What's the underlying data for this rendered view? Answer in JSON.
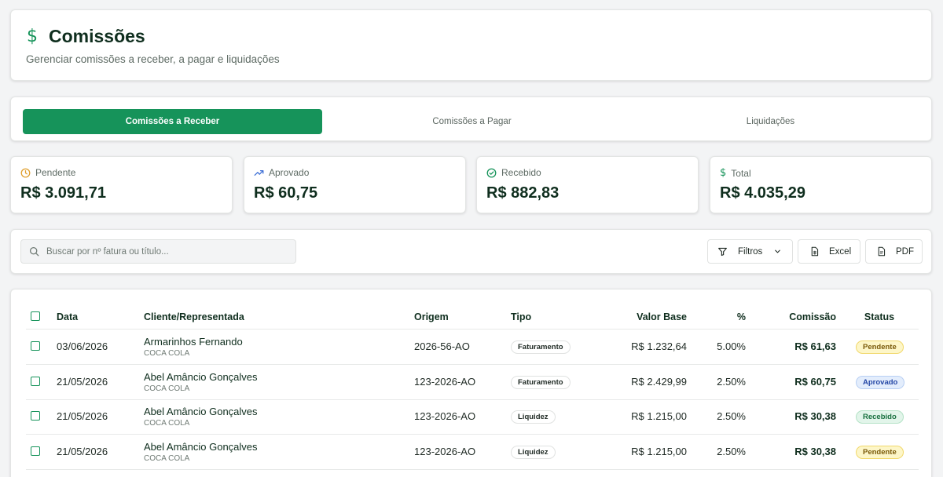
{
  "header": {
    "icon": "dollar-icon",
    "title": "Comissões",
    "subtitle": "Gerenciar comissões a receber, a pagar e liquidações"
  },
  "tabs": [
    {
      "label": "Comissões a Receber",
      "active": true
    },
    {
      "label": "Comissões a Pagar",
      "active": false
    },
    {
      "label": "Liquidações",
      "active": false
    }
  ],
  "stats": [
    {
      "label": "Pendente",
      "value": "R$ 3.091,71",
      "icon": "clock-icon",
      "color": "#e0a030"
    },
    {
      "label": "Aprovado",
      "value": "R$ 60,75",
      "icon": "trending-up-icon",
      "color": "#3d6fd6"
    },
    {
      "label": "Recebido",
      "value": "R$ 882,83",
      "icon": "check-circle-icon",
      "color": "#16935a"
    },
    {
      "label": "Total",
      "value": "R$ 4.035,29",
      "icon": "dollar-icon",
      "color": "#16935a"
    }
  ],
  "toolbar": {
    "search_placeholder": "Buscar por nº fatura ou título...",
    "filters_label": "Filtros",
    "excel_label": "Excel",
    "pdf_label": "PDF"
  },
  "table": {
    "columns": {
      "data": "Data",
      "cliente": "Cliente/Representada",
      "origem": "Origem",
      "tipo": "Tipo",
      "valor_base": "Valor Base",
      "percent": "%",
      "comissao": "Comissão",
      "status": "Status"
    },
    "rows": [
      {
        "data": "03/06/2026",
        "cliente": "Armarinhos Fernando",
        "representada": "COCA COLA",
        "origem": "2026-56-AO",
        "tipo": "Faturamento",
        "valor_base": "R$ 1.232,64",
        "percent": "5.00%",
        "comissao": "R$ 61,63",
        "status": "Pendente"
      },
      {
        "data": "21/05/2026",
        "cliente": "Abel Amâncio Gonçalves",
        "representada": "COCA COLA",
        "origem": "123-2026-AO",
        "tipo": "Faturamento",
        "valor_base": "R$ 2.429,99",
        "percent": "2.50%",
        "comissao": "R$ 60,75",
        "status": "Aprovado"
      },
      {
        "data": "21/05/2026",
        "cliente": "Abel Amâncio Gonçalves",
        "representada": "COCA COLA",
        "origem": "123-2026-AO",
        "tipo": "Liquidez",
        "valor_base": "R$ 1.215,00",
        "percent": "2.50%",
        "comissao": "R$ 30,38",
        "status": "Recebido"
      },
      {
        "data": "21/05/2026",
        "cliente": "Abel Amâncio Gonçalves",
        "representada": "COCA COLA",
        "origem": "123-2026-AO",
        "tipo": "Liquidez",
        "valor_base": "R$ 1.215,00",
        "percent": "2.50%",
        "comissao": "R$ 30,38",
        "status": "Pendente"
      }
    ]
  }
}
